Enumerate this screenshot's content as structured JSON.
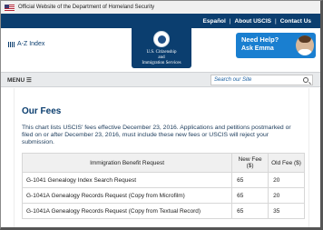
{
  "gov_banner": {
    "text": "Official Website of the Department of Homeland Security"
  },
  "top_links": [
    "Español",
    "About USCIS",
    "Contact Us"
  ],
  "header": {
    "az_index": "A-Z Index",
    "seal_line1": "U.S. Citizenship",
    "seal_line2": "and",
    "seal_line3": "Immigration Services",
    "help_title": "Need Help?",
    "help_sub": "Ask Emma"
  },
  "menubar": {
    "menu_label": "MENU ☰",
    "search_placeholder": "Search our Site"
  },
  "main": {
    "title": "Our Fees",
    "intro": "This chart lists USCIS' fees effective December 23, 2016. Applications and petitions postmarked or filed on or after December 23, 2016, must include these new fees or USCIS will reject your submission.",
    "table": {
      "headers": [
        "Immigration Benefit Request",
        "New Fee ($)",
        "Old Fee ($)"
      ],
      "rows": [
        [
          "G-1041 Genealogy Index Search Request",
          "65",
          "20"
        ],
        [
          "G-1041A Genealogy Records Request (Copy from Microfilm)",
          "65",
          "20"
        ],
        [
          "G-1041A Genealogy Records Request (Copy from Textual Record)",
          "65",
          "35"
        ]
      ]
    }
  },
  "colors": {
    "brand_navy": "#0b3e6f",
    "help_blue": "#1a7fd0"
  }
}
